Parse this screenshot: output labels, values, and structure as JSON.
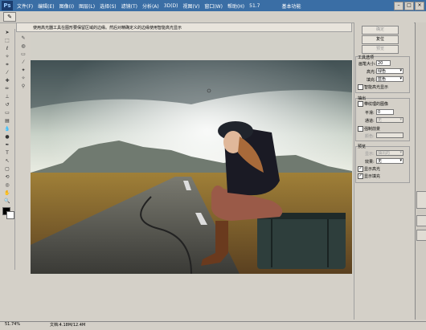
{
  "menubar": {
    "logo": "Ps",
    "items": [
      "文件(F)",
      "编辑(E)",
      "图像(I)",
      "图层(L)",
      "选择(S)",
      "滤镜(T)",
      "分析(A)",
      "3D(D)",
      "视图(V)",
      "窗口(W)",
      "帮助(H)"
    ],
    "zoom": "51.7",
    "workspace": "基本功能",
    "controls": [
      "minimize",
      "maximize",
      "close"
    ]
  },
  "instruction": "使用高光器工具在图形要保留区域的边缘。然后对精确定义的边缘使用智能高光显示",
  "buttons": {
    "ok": "确定",
    "reset": "复位",
    "preview": "预览"
  },
  "tool_options": {
    "title": "工具选项",
    "brush_size_label": "画笔大小:",
    "brush_size_value": "20",
    "highlight_label": "高光:",
    "highlight_value": "绿色",
    "fill_label": "填充:",
    "fill_value": "蓝色",
    "smart_highlight_label": "智能高光显示"
  },
  "extraction": {
    "title": "抽出",
    "textured_label": "带纹理的图像",
    "smooth_label": "平滑:",
    "smooth_value": "0",
    "channel_label": "通道:",
    "channel_value": "无",
    "force_fg_label": "强制前景",
    "color_label": "颜色:"
  },
  "preview": {
    "title": "预览",
    "show_label": "显示:",
    "show_value": "抽出的",
    "effect_label": "效果:",
    "effect_value": "无",
    "show_highlight_label": "显示高光",
    "show_fill_label": "显示填充"
  },
  "status": {
    "zoom": "51.74%",
    "doc": "文档:4.18M/12.4M"
  },
  "colors": {
    "titlebar": "#3a6ea5",
    "panel": "#d4d0c8",
    "foreground": "#000000",
    "background": "#ffffff"
  }
}
